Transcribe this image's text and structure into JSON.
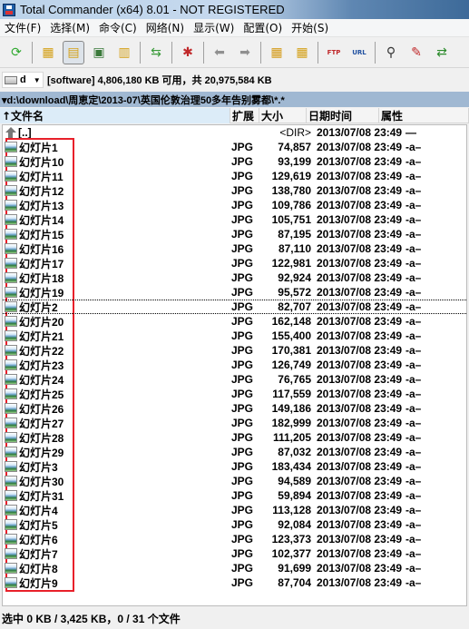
{
  "window": {
    "title": "Total Commander (x64) 8.01 - NOT REGISTERED"
  },
  "menu": [
    "文件(F)",
    "选择(M)",
    "命令(C)",
    "网络(N)",
    "显示(W)",
    "配置(O)",
    "开始(S)"
  ],
  "toolbar": [
    {
      "name": "refresh-icon",
      "glyph": "⟳",
      "color": "#2ea82e"
    },
    {
      "sep": true
    },
    {
      "name": "brief-view-icon",
      "glyph": "▦",
      "color": "#d4a017"
    },
    {
      "name": "full-view-icon",
      "glyph": "▤",
      "color": "#d4a017",
      "active": true
    },
    {
      "name": "thumbnail-view-icon",
      "glyph": "▣",
      "color": "#3a7a3a"
    },
    {
      "name": "tree-view-icon",
      "glyph": "▥",
      "color": "#d4a017"
    },
    {
      "sep": true
    },
    {
      "name": "sync-dirs-icon",
      "glyph": "⇆",
      "color": "#3a9a3a"
    },
    {
      "sep": true
    },
    {
      "name": "plugin-icon",
      "glyph": "✱",
      "color": "#c0282a"
    },
    {
      "sep": true
    },
    {
      "name": "back-icon",
      "glyph": "⬅",
      "color": "#909090"
    },
    {
      "name": "forward-icon",
      "glyph": "➡",
      "color": "#909090"
    },
    {
      "sep": true
    },
    {
      "name": "pack-icon",
      "glyph": "▦",
      "color": "#d49a17"
    },
    {
      "name": "unpack-icon",
      "glyph": "▦",
      "color": "#d4a017"
    },
    {
      "sep": true
    },
    {
      "name": "ftp-icon",
      "glyph": "FTP",
      "color": "#c0282a"
    },
    {
      "name": "url-icon",
      "glyph": "URL",
      "color": "#2050a0"
    },
    {
      "sep": true
    },
    {
      "name": "search-binoculars-icon",
      "glyph": "⚲",
      "color": "#333333"
    },
    {
      "name": "multi-rename-icon",
      "glyph": "✎",
      "color": "#c0282a"
    },
    {
      "name": "compare-dirs-icon",
      "glyph": "⇄",
      "color": "#2a8a2a"
    }
  ],
  "drive": {
    "letter": "d",
    "info": "[software]  4,806,180 KB 可用，共 20,975,584 KB"
  },
  "path": "▾d:\\download\\周恵定\\2013-07\\英国伦敦治理50多年告别雾都\\*.*",
  "columns": {
    "name": "↑文件名",
    "ext": "扩展",
    "size": "大小",
    "date": "日期时间",
    "attr": "属性"
  },
  "parent": {
    "name": "[..]",
    "size": "<DIR>",
    "date": "2013/07/08 23:49",
    "attr": "—"
  },
  "files": [
    {
      "name": "幻灯片1",
      "ext": "JPG",
      "size": "74,857",
      "date": "2013/07/08 23:49",
      "attr": "-a–"
    },
    {
      "name": "幻灯片10",
      "ext": "JPG",
      "size": "93,199",
      "date": "2013/07/08 23:49",
      "attr": "-a–"
    },
    {
      "name": "幻灯片11",
      "ext": "JPG",
      "size": "129,619",
      "date": "2013/07/08 23:49",
      "attr": "-a–"
    },
    {
      "name": "幻灯片12",
      "ext": "JPG",
      "size": "138,780",
      "date": "2013/07/08 23:49",
      "attr": "-a–"
    },
    {
      "name": "幻灯片13",
      "ext": "JPG",
      "size": "109,786",
      "date": "2013/07/08 23:49",
      "attr": "-a–"
    },
    {
      "name": "幻灯片14",
      "ext": "JPG",
      "size": "105,751",
      "date": "2013/07/08 23:49",
      "attr": "-a–"
    },
    {
      "name": "幻灯片15",
      "ext": "JPG",
      "size": "87,195",
      "date": "2013/07/08 23:49",
      "attr": "-a–"
    },
    {
      "name": "幻灯片16",
      "ext": "JPG",
      "size": "87,110",
      "date": "2013/07/08 23:49",
      "attr": "-a–"
    },
    {
      "name": "幻灯片17",
      "ext": "JPG",
      "size": "122,981",
      "date": "2013/07/08 23:49",
      "attr": "-a–"
    },
    {
      "name": "幻灯片18",
      "ext": "JPG",
      "size": "92,924",
      "date": "2013/07/08 23:49",
      "attr": "-a–"
    },
    {
      "name": "幻灯片19",
      "ext": "JPG",
      "size": "95,572",
      "date": "2013/07/08 23:49",
      "attr": "-a–"
    },
    {
      "name": "幻灯片2",
      "ext": "JPG",
      "size": "82,707",
      "date": "2013/07/08 23:49",
      "attr": "-a–",
      "cursor": true
    },
    {
      "name": "幻灯片20",
      "ext": "JPG",
      "size": "162,148",
      "date": "2013/07/08 23:49",
      "attr": "-a–"
    },
    {
      "name": "幻灯片21",
      "ext": "JPG",
      "size": "155,400",
      "date": "2013/07/08 23:49",
      "attr": "-a–"
    },
    {
      "name": "幻灯片22",
      "ext": "JPG",
      "size": "170,381",
      "date": "2013/07/08 23:49",
      "attr": "-a–"
    },
    {
      "name": "幻灯片23",
      "ext": "JPG",
      "size": "126,749",
      "date": "2013/07/08 23:49",
      "attr": "-a–"
    },
    {
      "name": "幻灯片24",
      "ext": "JPG",
      "size": "76,765",
      "date": "2013/07/08 23:49",
      "attr": "-a–"
    },
    {
      "name": "幻灯片25",
      "ext": "JPG",
      "size": "117,559",
      "date": "2013/07/08 23:49",
      "attr": "-a–"
    },
    {
      "name": "幻灯片26",
      "ext": "JPG",
      "size": "149,186",
      "date": "2013/07/08 23:49",
      "attr": "-a–"
    },
    {
      "name": "幻灯片27",
      "ext": "JPG",
      "size": "182,999",
      "date": "2013/07/08 23:49",
      "attr": "-a–"
    },
    {
      "name": "幻灯片28",
      "ext": "JPG",
      "size": "111,205",
      "date": "2013/07/08 23:49",
      "attr": "-a–"
    },
    {
      "name": "幻灯片29",
      "ext": "JPG",
      "size": "87,032",
      "date": "2013/07/08 23:49",
      "attr": "-a–"
    },
    {
      "name": "幻灯片3",
      "ext": "JPG",
      "size": "183,434",
      "date": "2013/07/08 23:49",
      "attr": "-a–"
    },
    {
      "name": "幻灯片30",
      "ext": "JPG",
      "size": "94,589",
      "date": "2013/07/08 23:49",
      "attr": "-a–"
    },
    {
      "name": "幻灯片31",
      "ext": "JPG",
      "size": "59,894",
      "date": "2013/07/08 23:49",
      "attr": "-a–"
    },
    {
      "name": "幻灯片4",
      "ext": "JPG",
      "size": "113,128",
      "date": "2013/07/08 23:49",
      "attr": "-a–"
    },
    {
      "name": "幻灯片5",
      "ext": "JPG",
      "size": "92,084",
      "date": "2013/07/08 23:49",
      "attr": "-a–"
    },
    {
      "name": "幻灯片6",
      "ext": "JPG",
      "size": "123,373",
      "date": "2013/07/08 23:49",
      "attr": "-a–"
    },
    {
      "name": "幻灯片7",
      "ext": "JPG",
      "size": "102,377",
      "date": "2013/07/08 23:49",
      "attr": "-a–"
    },
    {
      "name": "幻灯片8",
      "ext": "JPG",
      "size": "91,699",
      "date": "2013/07/08 23:49",
      "attr": "-a–"
    },
    {
      "name": "幻灯片9",
      "ext": "JPG",
      "size": "87,704",
      "date": "2013/07/08 23:49",
      "attr": "-a–"
    }
  ],
  "status": "选中 0 KB / 3,425 KB，0 / 31 个文件",
  "colors": {
    "highlight_border": "#e8202a",
    "path_bar": "#a0b8d2"
  }
}
